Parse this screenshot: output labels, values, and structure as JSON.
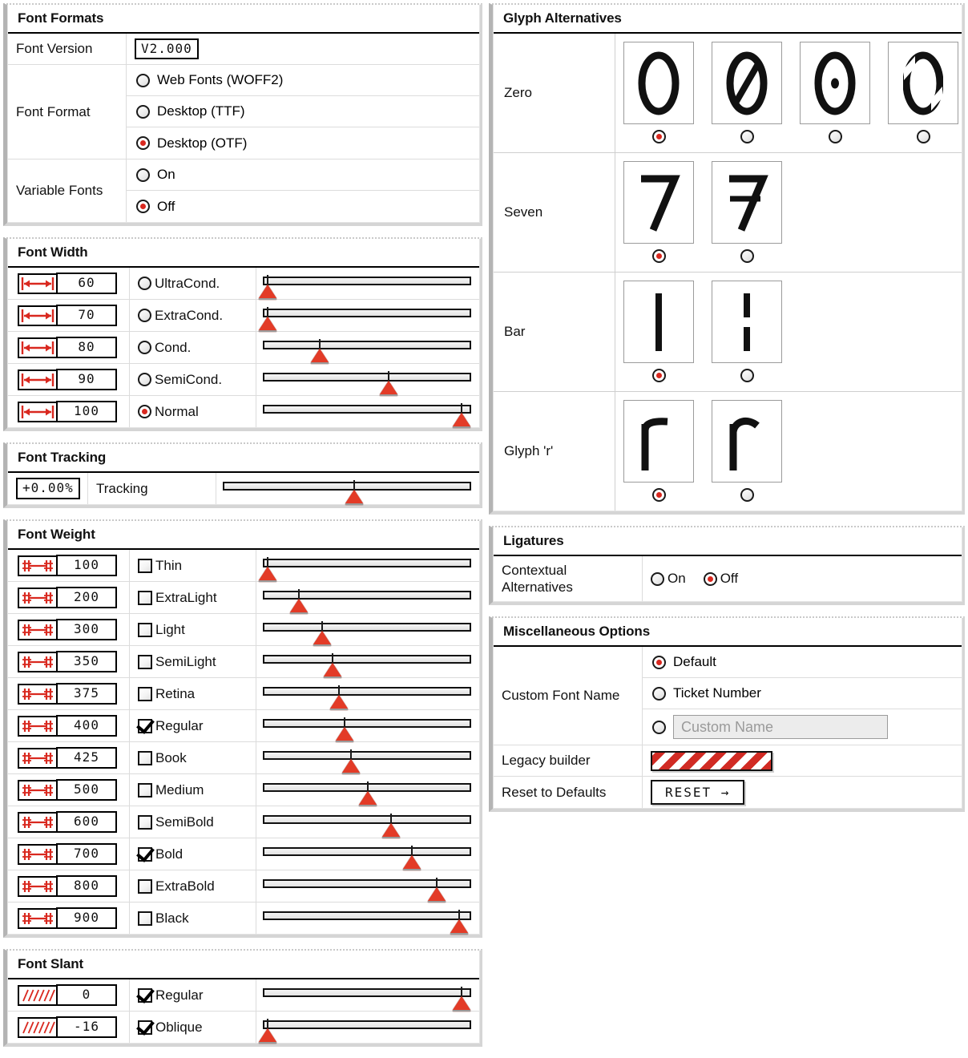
{
  "font_formats": {
    "title": "Font Formats",
    "version_label": "Font Version",
    "version_value": "V2.000",
    "format_label": "Font Format",
    "format_options": [
      {
        "label": "Web Fonts (WOFF2)",
        "selected": false
      },
      {
        "label": "Desktop (TTF)",
        "selected": false
      },
      {
        "label": "Desktop (OTF)",
        "selected": true
      }
    ],
    "variable_label": "Variable Fonts",
    "variable_options": [
      {
        "label": "On",
        "selected": false
      },
      {
        "label": "Off",
        "selected": true
      }
    ]
  },
  "font_width": {
    "title": "Font Width",
    "icon": "width-arrow-icon",
    "rows": [
      {
        "value": "60",
        "label": "UltraCond.",
        "selected": false,
        "pos": 2
      },
      {
        "value": "70",
        "label": "ExtraCond.",
        "selected": false,
        "pos": 2
      },
      {
        "value": "80",
        "label": "Cond.",
        "selected": false,
        "pos": 27
      },
      {
        "value": "90",
        "label": "SemiCond.",
        "selected": false,
        "pos": 60
      },
      {
        "value": "100",
        "label": "Normal",
        "selected": true,
        "pos": 95
      }
    ]
  },
  "font_tracking": {
    "title": "Font Tracking",
    "value": "+0.00%",
    "label": "Tracking",
    "pos": 52
  },
  "font_weight": {
    "title": "Font Weight",
    "icon": "weight-dumbbell-icon",
    "rows": [
      {
        "value": "100",
        "label": "Thin",
        "checked": false,
        "pos": 2
      },
      {
        "value": "200",
        "label": "ExtraLight",
        "checked": false,
        "pos": 17
      },
      {
        "value": "300",
        "label": "Light",
        "checked": false,
        "pos": 28
      },
      {
        "value": "350",
        "label": "SemiLight",
        "checked": false,
        "pos": 33
      },
      {
        "value": "375",
        "label": "Retina",
        "checked": false,
        "pos": 36
      },
      {
        "value": "400",
        "label": "Regular",
        "checked": true,
        "pos": 39
      },
      {
        "value": "425",
        "label": "Book",
        "checked": false,
        "pos": 42
      },
      {
        "value": "500",
        "label": "Medium",
        "checked": false,
        "pos": 50
      },
      {
        "value": "600",
        "label": "SemiBold",
        "checked": false,
        "pos": 61
      },
      {
        "value": "700",
        "label": "Bold",
        "checked": true,
        "pos": 71
      },
      {
        "value": "800",
        "label": "ExtraBold",
        "checked": false,
        "pos": 83
      },
      {
        "value": "900",
        "label": "Black",
        "checked": false,
        "pos": 94
      }
    ]
  },
  "font_slant": {
    "title": "Font Slant",
    "icon": "slant-hatch-icon",
    "rows": [
      {
        "value": "0",
        "label": "Regular",
        "checked": true,
        "pos": 95
      },
      {
        "value": "-16",
        "label": "Oblique",
        "checked": true,
        "pos": 2
      }
    ]
  },
  "glyph_alternatives": {
    "title": "Glyph Alternatives",
    "rows": [
      {
        "label": "Zero",
        "items": [
          {
            "glyph": "zero-plain",
            "selected": true
          },
          {
            "glyph": "zero-slashed",
            "selected": false
          },
          {
            "glyph": "zero-dotted",
            "selected": false
          },
          {
            "glyph": "zero-cut",
            "selected": false
          }
        ]
      },
      {
        "label": "Seven",
        "items": [
          {
            "glyph": "seven-plain",
            "selected": true
          },
          {
            "glyph": "seven-slashed",
            "selected": false
          }
        ]
      },
      {
        "label": "Bar",
        "items": [
          {
            "glyph": "bar-solid",
            "selected": true
          },
          {
            "glyph": "bar-broken",
            "selected": false
          }
        ]
      },
      {
        "label": "Glyph 'r'",
        "items": [
          {
            "glyph": "r-straight",
            "selected": true
          },
          {
            "glyph": "r-curved",
            "selected": false
          }
        ]
      }
    ]
  },
  "ligatures": {
    "title": "Ligatures",
    "label": "Contextual Alternatives",
    "options": [
      {
        "label": "On",
        "selected": false
      },
      {
        "label": "Off",
        "selected": true
      }
    ]
  },
  "misc": {
    "title": "Miscellaneous Options",
    "custom_font_name_label": "Custom Font Name",
    "custom_font_name_options": [
      {
        "label": "Default",
        "selected": true
      },
      {
        "label": "Ticket Number",
        "selected": false
      }
    ],
    "custom_name_placeholder": "Custom Name",
    "custom_name_selected": false,
    "legacy_label": "Legacy builder",
    "legacy_swatch": "red-diagonal-stripes",
    "reset_label": "Reset to Defaults",
    "reset_button": "RESET →"
  },
  "colors": {
    "accent_red": "#d9281f",
    "thumb_red": "#e33b27",
    "stripe_red": "#d12b24",
    "rule": "#000000"
  }
}
